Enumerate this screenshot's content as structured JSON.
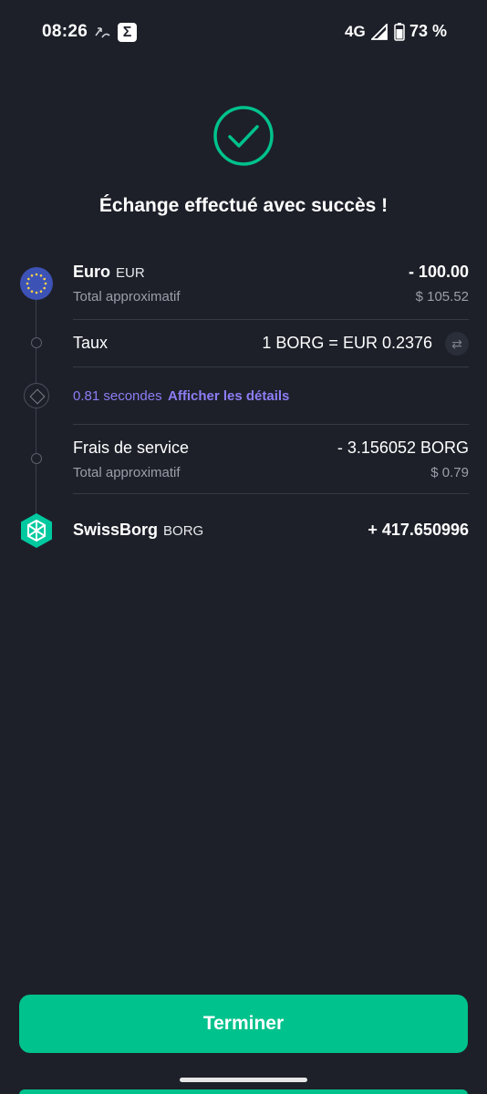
{
  "status_bar": {
    "time": "08:26",
    "notification_icons": [
      "missed-call-icon",
      "sigma-app-icon"
    ],
    "app_icon_glyph": "Σ",
    "network": "4G",
    "battery": "73 %"
  },
  "header": {
    "title": "Échange effectué avec succès !"
  },
  "from": {
    "name": "Euro",
    "code": "EUR",
    "amount": "- 100.00",
    "approx_label": "Total approximatif",
    "approx_value": "$ 105.52"
  },
  "rate": {
    "label": "Taux",
    "value": "1 BORG = EUR 0.2376"
  },
  "timing": {
    "duration": "0.81 secondes",
    "details_link": "Afficher les détails"
  },
  "fees": {
    "label": "Frais de service",
    "amount": "- 3.156052 BORG",
    "approx_label": "Total approximatif",
    "approx_value": "$ 0.79"
  },
  "to": {
    "name": "SwissBorg",
    "code": "BORG",
    "amount": "+ 417.650996"
  },
  "footer": {
    "button_label": "Terminer"
  },
  "colors": {
    "background": "#1d2029",
    "accent_green": "#00c28c",
    "link_purple": "#8b7ef5",
    "muted_text": "#9a9ea8"
  }
}
